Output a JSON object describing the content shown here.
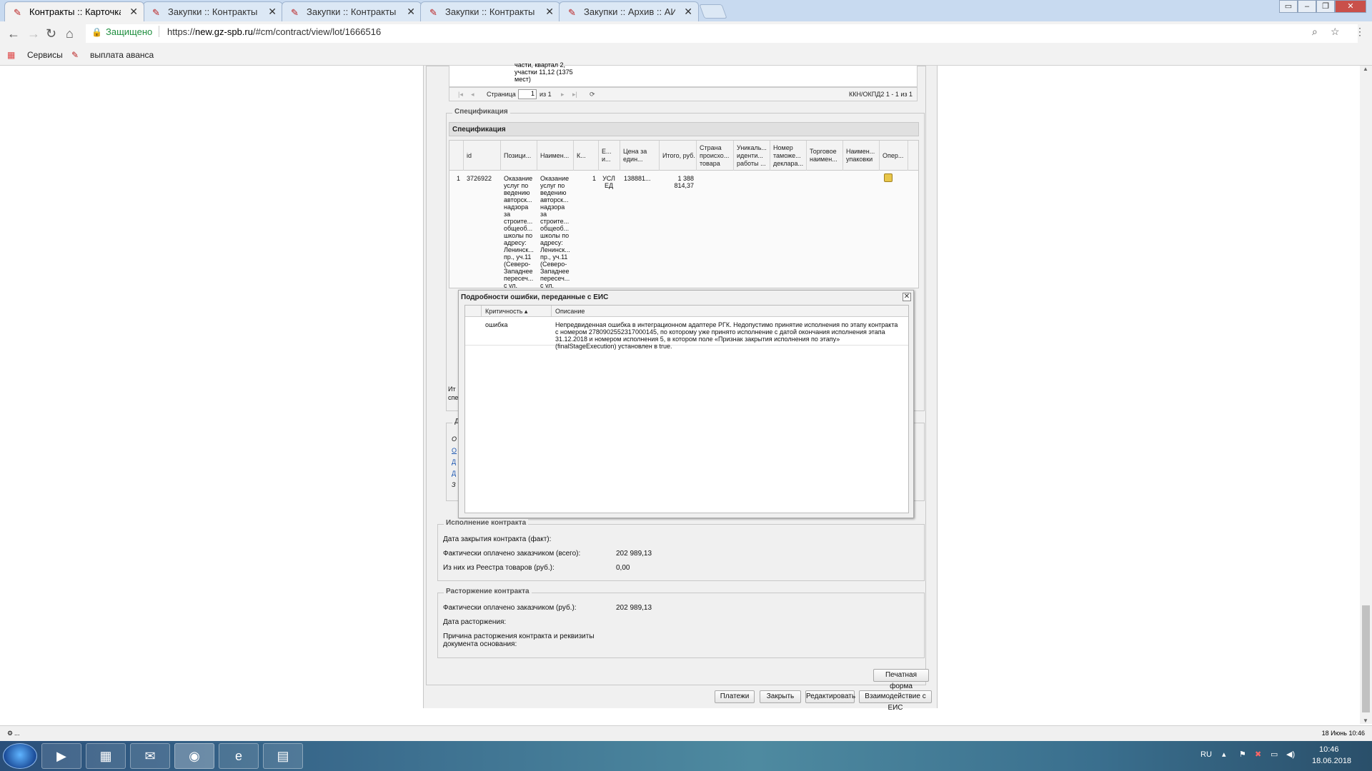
{
  "browser": {
    "tabs": [
      {
        "title": "Контракты :: Карточка к",
        "active": true
      },
      {
        "title": "Закупки :: Контракты на",
        "active": false
      },
      {
        "title": "Закупки :: Контракты на",
        "active": false
      },
      {
        "title": "Закупки :: Контракты на",
        "active": false
      },
      {
        "title": "Закупки :: Архив :: АИС Г",
        "active": false
      }
    ],
    "secure_label": "Защищено",
    "url_scheme": "https://",
    "url_host": "new.gz-spb.ru",
    "url_path": "/#cm/contract/view/lot/1666516",
    "bookmarks": [
      {
        "label": "Сервисы",
        "icon": "apps-grid-icon"
      },
      {
        "label": "выплата аванса",
        "icon": "bookmark-favicon-icon"
      }
    ]
  },
  "okpd": {
    "row_text": "части, квартал 2, участки 11,12 (1375 мест)",
    "page_label": "Страница",
    "page_value": "1",
    "page_of": "из 1",
    "summary": "ККН/ОКПД2 1 - 1 из 1"
  },
  "spec": {
    "legend": "Спецификация",
    "panel_title": "Спецификация",
    "columns": [
      "id",
      "Позици...",
      "Наимен...",
      "К...",
      "Е... и...",
      "Цена за един...",
      "Итого, руб.",
      "Страна происхо... товара",
      "Уникаль... иденти... работы ...",
      "Номер таможе... деклара...",
      "Торговое наимен...",
      "Наимен... упаковки",
      "Опер..."
    ],
    "row": {
      "num": "1",
      "id": "3726922",
      "position": "Оказание услуг по ведению авторск... надзора за строите... общеоб... школы по адресу: Ленинск... пр., уч.11 (Северо-Западнее пересеч... с ул.",
      "name": "Оказание услуг по ведению авторск... надзора за строите... общеоб... школы по адресу: Ленинск... пр., уч.11 (Северо-Западнее пересеч... с ул.",
      "qty": "1",
      "unit": "УСЛ ЕД",
      "price": "138881...",
      "total": "1 388 814,37"
    }
  },
  "error_dialog": {
    "title": "Подробности ошибки, переданные с ЕИС",
    "col_severity": "Критичность",
    "col_description": "Описание",
    "row": {
      "severity": "ошибка",
      "description": "Непредвиденная ошибка в интеграционном адаптере РГК. Недопустимо принятие исполнения по этапу контракта с номером 2780902552317000145, по которому уже принято исполнение с датой окончания исполнения этапа 31.12.2018 и номером исполнения 5, в котором поле «Признак закрытия исполнения по этапу» (finalStageExecution) установлен в true."
    }
  },
  "obscured": {
    "left_fragment_1": "Ит",
    "left_fragment_2": "спе",
    "doc_legend": "До",
    "doc_links": [
      "О",
      "О",
      "Д",
      "Д",
      "З"
    ]
  },
  "execution": {
    "legend": "Исполнение контракта",
    "rows": [
      {
        "label": "Дата закрытия контракта (факт):",
        "value": ""
      },
      {
        "label": "Фактически оплачено заказчиком (всего):",
        "value": "202 989,13"
      },
      {
        "label": "Из них из Реестра товаров (руб.):",
        "value": "0,00"
      }
    ]
  },
  "termination": {
    "legend": "Расторжение контракта",
    "rows": [
      {
        "label": "Фактически оплачено заказчиком (руб.):",
        "value": "202 989,13"
      },
      {
        "label": "Дата расторжения:",
        "value": ""
      },
      {
        "label": "Причина расторжения контракта и реквизиты документа основания:",
        "value": ""
      }
    ]
  },
  "buttons": {
    "print_form": "Печатная форма",
    "payments": "Платежи",
    "close": "Закрыть",
    "edit": "Редактировать",
    "eis": "Взаимодействие с ЕИС"
  },
  "status": {
    "left": "...",
    "right": "18 Июнь 10:46"
  },
  "taskbar": {
    "lang": "RU",
    "time": "10:46",
    "date": "18.06.2018"
  }
}
